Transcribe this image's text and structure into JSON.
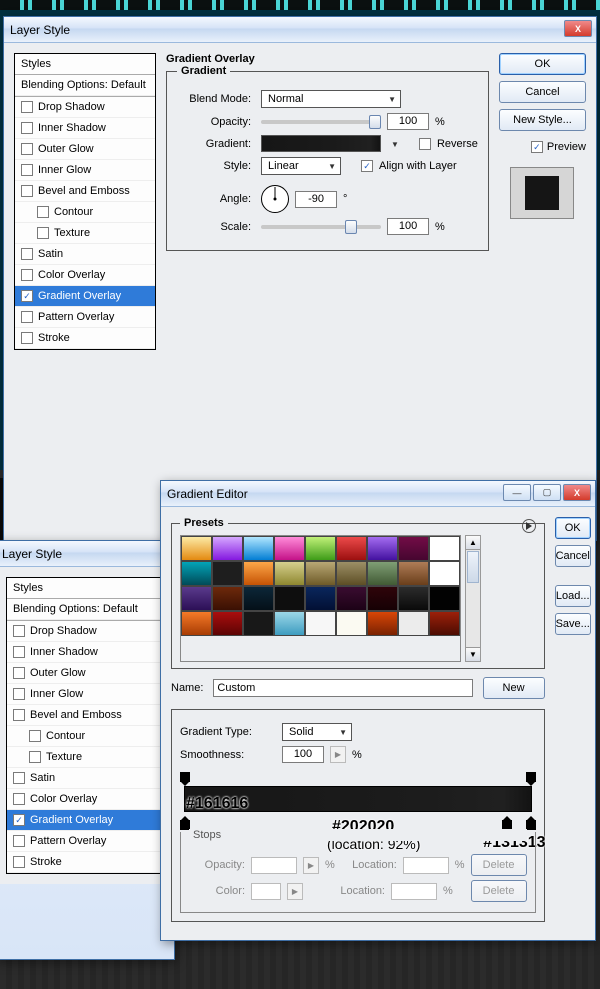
{
  "layer_style": {
    "title": "Layer Style",
    "styles_header": "Styles",
    "blending_default": "Blending Options: Default",
    "items": [
      {
        "label": "Drop Shadow",
        "indent": false,
        "checked": false
      },
      {
        "label": "Inner Shadow",
        "indent": false,
        "checked": false
      },
      {
        "label": "Outer Glow",
        "indent": false,
        "checked": false
      },
      {
        "label": "Inner Glow",
        "indent": false,
        "checked": false
      },
      {
        "label": "Bevel and Emboss",
        "indent": false,
        "checked": false
      },
      {
        "label": "Contour",
        "indent": true,
        "checked": false
      },
      {
        "label": "Texture",
        "indent": true,
        "checked": false
      },
      {
        "label": "Satin",
        "indent": false,
        "checked": false
      },
      {
        "label": "Color Overlay",
        "indent": false,
        "checked": false
      },
      {
        "label": "Gradient Overlay",
        "indent": false,
        "checked": true,
        "selected": true
      },
      {
        "label": "Pattern Overlay",
        "indent": false,
        "checked": false
      },
      {
        "label": "Stroke",
        "indent": false,
        "checked": false
      }
    ],
    "panel_title": "Gradient Overlay",
    "sub_title": "Gradient",
    "blend_mode_label": "Blend Mode:",
    "blend_mode_value": "Normal",
    "opacity_label": "Opacity:",
    "opacity_value": "100",
    "percent": "%",
    "degree": "°",
    "gradient_label": "Gradient:",
    "reverse_label": "Reverse",
    "style_label": "Style:",
    "style_value": "Linear",
    "align_label": "Align with Layer",
    "angle_label": "Angle:",
    "angle_value": "-90",
    "scale_label": "Scale:",
    "scale_value": "100",
    "ok": "OK",
    "cancel": "Cancel",
    "new_style": "New Style...",
    "preview": "Preview"
  },
  "gradient_editor": {
    "title": "Gradient Editor",
    "presets_label": "Presets",
    "name_label": "Name:",
    "name_value": "Custom",
    "new_btn": "New",
    "type_label": "Gradient Type:",
    "type_value": "Solid",
    "smoothness_label": "Smoothness:",
    "smoothness_value": "100",
    "percent": "%",
    "stops_label": "Stops",
    "opacity_label": "Opacity:",
    "location_label": "Location:",
    "color_label": "Color:",
    "delete": "Delete",
    "ok": "OK",
    "cancel": "Cancel",
    "load": "Load...",
    "save": "Save...",
    "annotations": {
      "left_stop": "#161616",
      "mid_stop": "#202020",
      "mid_stop_loc": "(location: 92%)",
      "right_stop": "#131313"
    },
    "chart_data": {
      "type": "bar",
      "description": "Gradient color stops",
      "stops": [
        {
          "color": "#161616",
          "location": 0
        },
        {
          "color": "#202020",
          "location": 92
        },
        {
          "color": "#131313",
          "location": 100
        }
      ]
    },
    "preset_colors": [
      [
        "linear-gradient(#fceaa5,#e48a10)",
        "linear-gradient(#d5a7ff,#8418e0)",
        "linear-gradient(#b0e6ff,#027ed4)",
        "linear-gradient(#ff8bd9,#c41288)",
        "linear-gradient(#c0f078,#3e9c18)",
        "linear-gradient(#ec4a4a,#9c0f0f)",
        "linear-gradient(#a46cf0,#4311a0)",
        "linear-gradient(#720c46,#460630)",
        "#ffffff"
      ],
      [
        "linear-gradient(#02a4b8,#014a58)",
        "#1e1e1e",
        "linear-gradient(#fda648,#c55304)",
        "linear-gradient(#d6d08e,#8e8730)",
        "linear-gradient(#b8a875,#6e5a28)",
        "linear-gradient(#9c8f66,#5d4e25)",
        "linear-gradient(#7f9e75,#415a34)",
        "linear-gradient(#ae7c57,#6a3e1a)",
        "#ffffff"
      ],
      [
        "linear-gradient(#5a3a8c,#2c0f56)",
        "linear-gradient(#6d290b,#3a1003)",
        "linear-gradient(#0c2738,#041018)",
        "#0e0e0e",
        "linear-gradient(#0a265c,#021034)",
        "linear-gradient(#3a0c30,#1c0216)",
        "linear-gradient(#2f040a,#160104)",
        "linear-gradient(#2c2c2c,#0a0a0a)",
        "#020202"
      ],
      [
        "linear-gradient(#f57a28,#a83c04)",
        "linear-gradient(#aa0e0e,#5c0404)",
        "#181818",
        "linear-gradient(#9cd7e8,#3e9cc0)",
        "#f7f7f7",
        "#fbfaf2",
        "linear-gradient(#d84606,#7a2202)",
        "#ececec",
        "linear-gradient(#9c200a,#4c0c02)"
      ]
    ]
  }
}
